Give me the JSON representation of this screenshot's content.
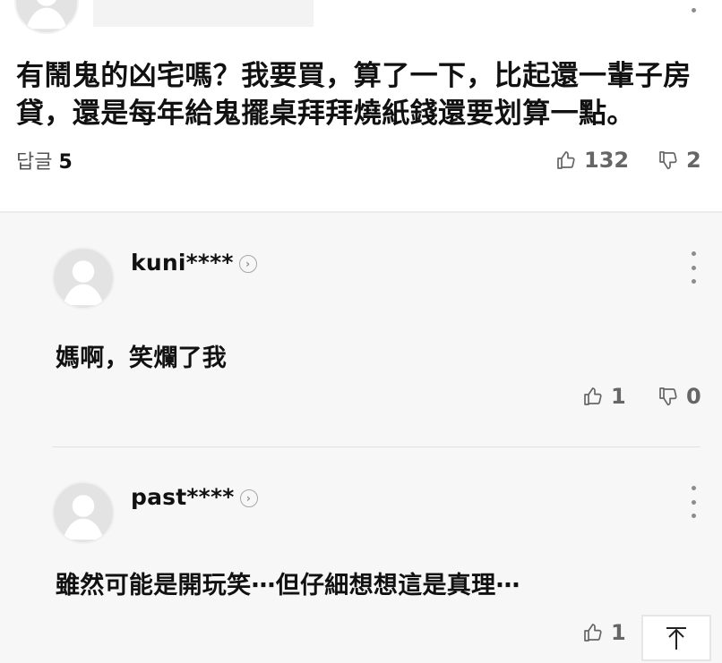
{
  "top_comment": {
    "text": "有鬧鬼的凶宅嗎？我要買，算了一下，比起還一輩子房貸，還是每年給鬼擺桌拜拜燒紙錢還要划算一點。",
    "replies_label": "답글",
    "replies_count": "5",
    "likes": "132",
    "dislikes": "2"
  },
  "replies": [
    {
      "author": "kuni****",
      "text": "媽啊，笑爛了我",
      "likes": "1",
      "dislikes": "0"
    },
    {
      "author": "past****",
      "text": "雖然可能是開玩笑⋯但仔細想想這是真理⋯",
      "likes": "1"
    }
  ],
  "icons": {
    "profile": "profile-icon",
    "more": "more-vertical-icon",
    "like": "thumb-up-icon",
    "dislike": "thumb-down-icon",
    "profile_arrow": "chevron-right-icon",
    "scroll_top": "arrow-up-icon"
  },
  "colors": {
    "text": "#111111",
    "muted": "#666666",
    "panel": "#f7f7f7",
    "avatar": "#e3e3e3"
  }
}
